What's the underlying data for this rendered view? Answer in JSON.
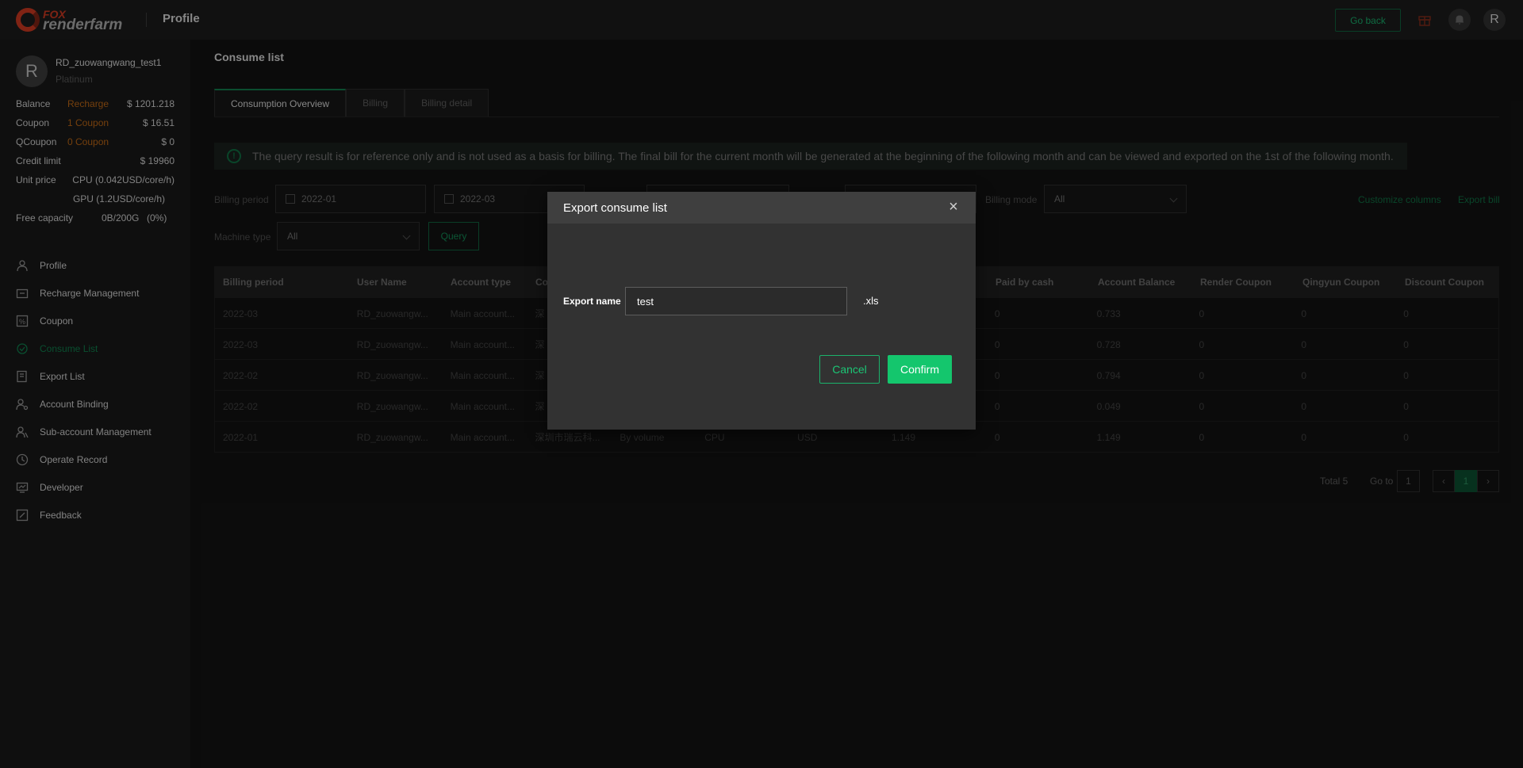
{
  "topbar": {
    "logo_top": "FOX",
    "logo_bottom": "renderfarm",
    "page_title": "Profile",
    "go_back": "Go back",
    "avatar_letter": "R"
  },
  "sidebar": {
    "avatar_letter": "R",
    "username": "RD_zuowangwang_test1",
    "level": "Platinum",
    "balance": {
      "label": "Balance",
      "link": "Recharge",
      "value": "$ 1201.218"
    },
    "coupon": {
      "label": "Coupon",
      "link": "1 Coupon",
      "value": "$ 16.51"
    },
    "qcoupon": {
      "label": "QCoupon",
      "link": "0 Coupon",
      "value": "$ 0"
    },
    "credit": {
      "label": "Credit limit",
      "value": "$ 19960"
    },
    "unit_price": {
      "label": "Unit price",
      "cpu": "CPU (0.042USD/core/h)",
      "gpu": "GPU (1.2USD/core/h)"
    },
    "free_capacity": {
      "label": "Free capacity",
      "value": "0B/200G",
      "pct": "(0%)"
    },
    "nav": [
      {
        "label": "Profile",
        "icon": "user-icon"
      },
      {
        "label": "Recharge Management",
        "icon": "wallet-icon"
      },
      {
        "label": "Coupon",
        "icon": "coupon-icon"
      },
      {
        "label": "Consume List",
        "icon": "consume-icon"
      },
      {
        "label": "Export List",
        "icon": "export-icon"
      },
      {
        "label": "Account Binding",
        "icon": "binding-icon"
      },
      {
        "label": "Sub-account Management",
        "icon": "subaccount-icon"
      },
      {
        "label": "Operate Record",
        "icon": "clock-icon"
      },
      {
        "label": "Developer",
        "icon": "developer-icon"
      },
      {
        "label": "Feedback",
        "icon": "feedback-icon"
      }
    ]
  },
  "main": {
    "title": "Consume list",
    "tabs": [
      "Consumption Overview",
      "Billing",
      "Billing detail"
    ],
    "notice": "The query result is for reference only and is not used as a basis for billing. The final bill for the current month will be generated at the beginning of the following month and can be viewed and exported on the 1st of the following month.",
    "filters": {
      "billing_period_label": "Billing period",
      "start": "2022-01",
      "end": "2022-03",
      "billing_mode_label": "Billing mode",
      "billing_mode_value": "All",
      "machine_type_label": "Machine type",
      "machine_type_value": "All",
      "query": "Query"
    },
    "customize_columns": "Customize columns",
    "export_bill": "Export bill",
    "table": {
      "headers": [
        "Billing period",
        "User Name",
        "Account type",
        "Co",
        "",
        "",
        "",
        "",
        "Paid by cash",
        "Account Balance",
        "Render Coupon",
        "Qingyun Coupon",
        "Discount Coupon"
      ],
      "rows": [
        [
          "2022-03",
          "RD_zuowangw...",
          "Main account...",
          "深",
          "",
          "",
          "",
          "",
          "0",
          "0.733",
          "0",
          "0",
          "0"
        ],
        [
          "2022-03",
          "RD_zuowangw...",
          "Main account...",
          "深",
          "",
          "",
          "",
          "",
          "0",
          "0.728",
          "0",
          "0",
          "0"
        ],
        [
          "2022-02",
          "RD_zuowangw...",
          "Main account...",
          "深",
          "",
          "",
          "",
          "",
          "0",
          "0.794",
          "0",
          "0",
          "0"
        ],
        [
          "2022-02",
          "RD_zuowangw...",
          "Main account...",
          "深",
          "",
          "",
          "",
          "",
          "0",
          "0.049",
          "0",
          "0",
          "0"
        ],
        [
          "2022-01",
          "RD_zuowangw...",
          "Main account...",
          "深圳市瑞云科...",
          "By volume",
          "CPU",
          "USD",
          "1.149",
          "0",
          "1.149",
          "0",
          "0",
          "0"
        ]
      ]
    },
    "pager": {
      "total": "Total 5",
      "goto_label": "Go to",
      "goto_value": "1",
      "current": "1",
      "prev": "‹",
      "next": "›"
    }
  },
  "modal": {
    "title": "Export consume list",
    "close": "×",
    "export_label": "Export name",
    "export_value": "test",
    "extension": ".xls",
    "cancel": "Cancel",
    "confirm": "Confirm"
  }
}
